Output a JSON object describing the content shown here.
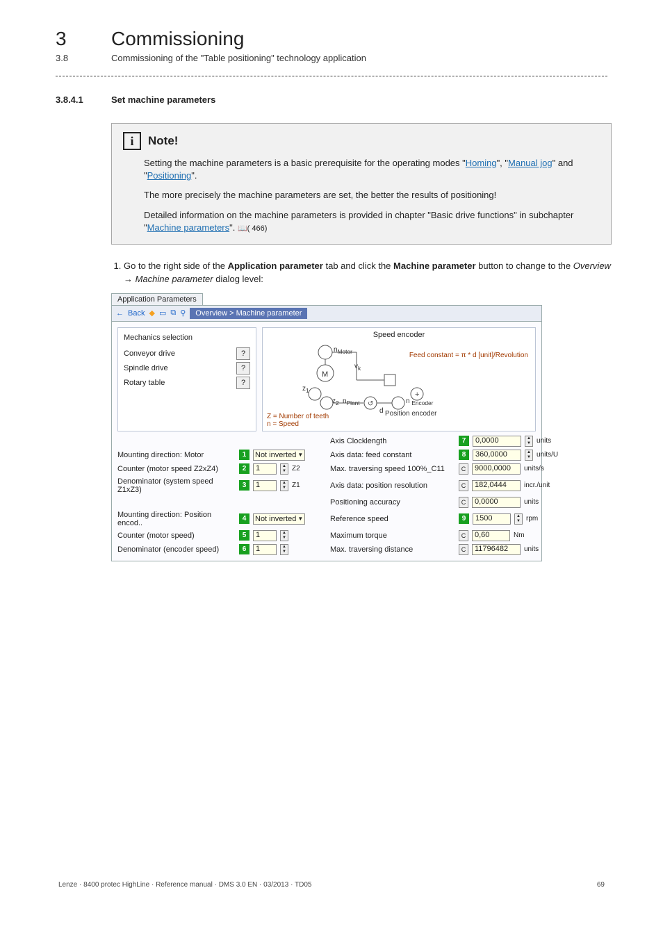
{
  "chapter": {
    "num": "3",
    "title": "Commissioning"
  },
  "sub": {
    "num": "3.8",
    "title": "Commissioning of the \"Table positioning\" technology application"
  },
  "section": {
    "num": "3.8.4.1",
    "title": "Set machine parameters"
  },
  "note": {
    "icon_glyph": "i",
    "heading": "Note!",
    "p1_a": "Setting the machine parameters is a basic prerequisite for the operating modes \"",
    "link_homing": "Homing",
    "p1_b": "\", \"",
    "link_manual_jog": "Manual jog",
    "p1_c": "\" and \"",
    "link_positioning": "Positioning",
    "p1_d": "\".",
    "p2": "The more precisely the machine parameters are set, the better the results of positioning!",
    "p3_a": "Detailed information on the machine parameters is provided in chapter \"Basic drive functions\" in subchapter \"",
    "link_machine_params": "Machine parameters",
    "p3_b": "\". ",
    "book_icon_text": "(     466)"
  },
  "step1": {
    "lead_a": "Go to the right side of the ",
    "bold_a": "Application parameter",
    "lead_b": " tab and click the ",
    "bold_b": "Machine parameter",
    "lead_c": " button to change to the ",
    "italic_a": "Overview ",
    "arrow": "→",
    "italic_b": " Machine parameter",
    "lead_d": " dialog level:"
  },
  "app": {
    "tab_label": "Application Parameters",
    "back": "Back",
    "crumb": "Overview > Machine parameter",
    "mech_title": "Mechanics selection",
    "mech_conveyor": "Conveyor drive",
    "mech_spindle": "Spindle drive",
    "mech_rotary": "Rotary table",
    "question": "?",
    "diag_title": "Speed encoder",
    "diag_n_motor": "n",
    "diag_n_motor_sub": "Motor",
    "diag_M": "M",
    "diag_vk": "v",
    "diag_vk_sub": "k",
    "diag_z1": "z",
    "diag_z1_sub": "1",
    "diag_z2": "z",
    "diag_z2_sub": "2",
    "diag_npiani": "n",
    "diag_npiani_sub": "Plant",
    "diag_feedconst": "Feed constant = π * d [unit]/Revolution",
    "diag_d": "d",
    "diag_nenc": "n ",
    "diag_nenc_sub": "Encoder",
    "diag_posenc": "Position encoder",
    "diag_footnote": "Z = Number of teeth\nn = Speed",
    "left": {
      "mount_motor_label": "Mounting direction: Motor",
      "mount_motor_num": "1",
      "mount_motor_val": "Not inverted",
      "counter_label": "Counter (motor speed Z2xZ4)",
      "counter_num": "2",
      "counter_val": "1",
      "counter_unit": "Z2",
      "denom_sys_label": "Denominator (system speed Z1xZ3)",
      "denom_sys_num": "3",
      "denom_sys_val": "1",
      "denom_sys_unit": "Z1",
      "mount_enc_label": "Mounting direction: Position encod..",
      "mount_enc_num": "4",
      "mount_enc_val": "Not inverted",
      "counter_motor_label": "Counter (motor speed)",
      "counter_motor_num": "5",
      "counter_motor_val": "1",
      "denom_enc_label": "Denominator (encoder speed)",
      "denom_enc_num": "6",
      "denom_enc_val": "1"
    },
    "right": {
      "clocklen_label": "Axis Clocklength",
      "clocklen_num": "7",
      "clocklen_val": "0,0000",
      "clocklen_unit": "units",
      "feedconst_label": "Axis data: feed constant",
      "feedconst_num": "8",
      "feedconst_val": "360,0000",
      "feedconst_unit": "units/U",
      "maxtrav_label": "Max. traversing speed 100%_C11",
      "maxtrav_val": "9000,0000",
      "maxtrav_unit": "units/s",
      "posres_label": "Axis data: position resolution",
      "posres_val": "182,0444",
      "posres_unit": "incr./unit",
      "posacc_label": "Positioning accuracy",
      "posacc_val": "0,0000",
      "posacc_unit": "units",
      "refspd_label": "Reference speed",
      "refspd_num": "9",
      "refspd_val": "1500",
      "refspd_unit": "rpm",
      "maxtorque_label": "Maximum torque",
      "maxtorque_val": "0,60",
      "maxtorque_unit": "Nm",
      "maxdist_label": "Max. traversing distance",
      "maxdist_val": "11796482",
      "maxdist_unit": "units"
    },
    "c_btn": "C"
  },
  "footer": {
    "left": "Lenze · 8400 protec HighLine · Reference manual · DMS 3.0 EN · 03/2013 · TD05",
    "right": "69"
  }
}
